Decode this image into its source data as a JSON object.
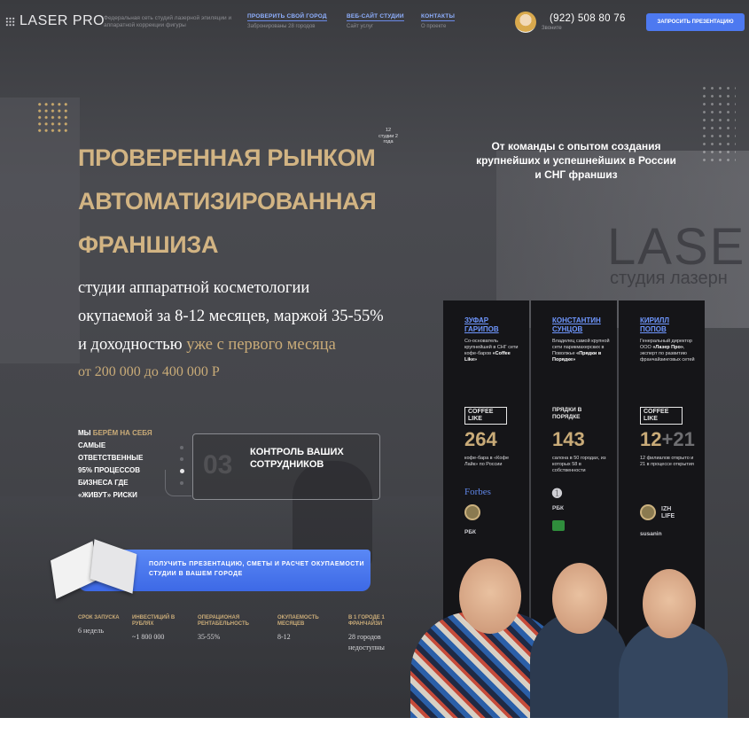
{
  "header": {
    "logo_text": "LASER PRO",
    "description": "Федеральная сеть студий лазерной эпиляции и аппаратной коррекции фигуры",
    "nav": [
      {
        "label": "ПРОВЕРИТЬ СВОЙ ГОРОД",
        "sub": "Забронированы 28 городов"
      },
      {
        "label": "ВЕБ-САЙТ СТУДИИ",
        "sub": "Сайт услуг"
      },
      {
        "label": "КОНТАКТЫ",
        "sub": "О проекте"
      }
    ],
    "phone": "(922) 508 80 76",
    "call_label": "Звоните",
    "cta_label": "ЗАПРОСИТЬ ПРЕЗЕНТАЦИЮ"
  },
  "hero": {
    "studios_badge": "12 студии 2 года",
    "title_lines": [
      "ПРОВЕРЕННАЯ РЫНКОМ",
      "АВТОМАТИЗИРОВАННАЯ",
      "ФРАНШИЗА"
    ],
    "subtitle_line1": "студии аппаратной косметологии",
    "subtitle_line2": "окупаемой за 8-12 месяцев, маржой 35-55%",
    "subtitle_line3_plain": "и доходностью ",
    "subtitle_line3_gold": "уже с первого месяца",
    "price": "от 200 000 до 400 000 Р",
    "risk_parts": {
      "a": "МЫ ",
      "b": "БЕРЁМ НА СЕБЯ",
      "c": " САМЫЕ ОТВЕТСТВЕННЫЕ 95% ПРОЦЕССОВ БИЗНЕСА ГДЕ «ЖИВУТ» РИСКИ"
    },
    "card_number": "03",
    "card_text": "КОНТРОЛЬ ВАШИХ СОТРУДНИКОВ",
    "cta": "ПОЛУЧИТЬ ПРЕЗЕНТАЦИЮ, СМЕТЫ И РАСЧЕТ ОКУПАЕМОСТИ СТУДИИ В ВАШЕМ ГОРОДЕ",
    "background_brand": "LASER",
    "background_brand_sub": "студия лазерн"
  },
  "stats": [
    {
      "label": "СРОК ЗАПУСКА",
      "value": "6 недель"
    },
    {
      "label": "ИНВЕСТИЦИЙ В РУБЛЯХ",
      "value": "~1 800 000"
    },
    {
      "label": "ОПЕРАЦИОНАЯ РЕНТАБЕЛЬНОСТЬ",
      "value": "35-55%"
    },
    {
      "label": "ОКУПАЕМОСТЬ МЕСЯЦЕВ",
      "value": "8-12"
    },
    {
      "label": "В 1 ГОРОДЕ 1 ФРАНЧАЙЗИ",
      "value": "28 городов недоступны"
    }
  ],
  "team": {
    "title": "От команды с опытом создания крупнейших и успешнейших в России и СНГ франшиз",
    "members": [
      {
        "name": "ЗУФАР ГАРИПОВ",
        "desc_plain": "Со-основатель крупнейшей в СНГ сети кофе-баров ",
        "desc_bold": "«Coffee Like»",
        "brand": "COFFEE LIKE",
        "number": "264",
        "number_desc": "кофе-бара в «Кофе Лайк» по России",
        "logos": [
          "Forbes",
          "РБК"
        ]
      },
      {
        "name": "КОНСТАНТИН СУНЦОВ",
        "desc_plain": "Владелец самой крупной сети парикмахерских в Поволжье ",
        "desc_bold": "«Прядки в Порядке»",
        "brand": "ПРЯДКИ В ПОРЯДКЕ",
        "number": "143",
        "number_desc": "салона в 50 городах, из которых 58 в собственности",
        "logos": [
          "РБК"
        ]
      },
      {
        "name": "КИРИЛЛ ПОПОВ",
        "desc_plain": "Генеральный директор ООО ",
        "desc_bold": "«Лазер Про»",
        "desc_rest": ", эксперт по развитию франчайзинговых сетей",
        "brand": "COFFEE LIKE",
        "number_main": "12",
        "number_plus": "+21",
        "number_desc": "12 филиалов открыто и 21 в процессе открытия",
        "logos": [
          "IZH LIFE",
          "susanin"
        ]
      }
    ]
  },
  "colors": {
    "accent_blue": "#4d79f0",
    "gold": "#c9ab78",
    "panel": "#151518"
  }
}
